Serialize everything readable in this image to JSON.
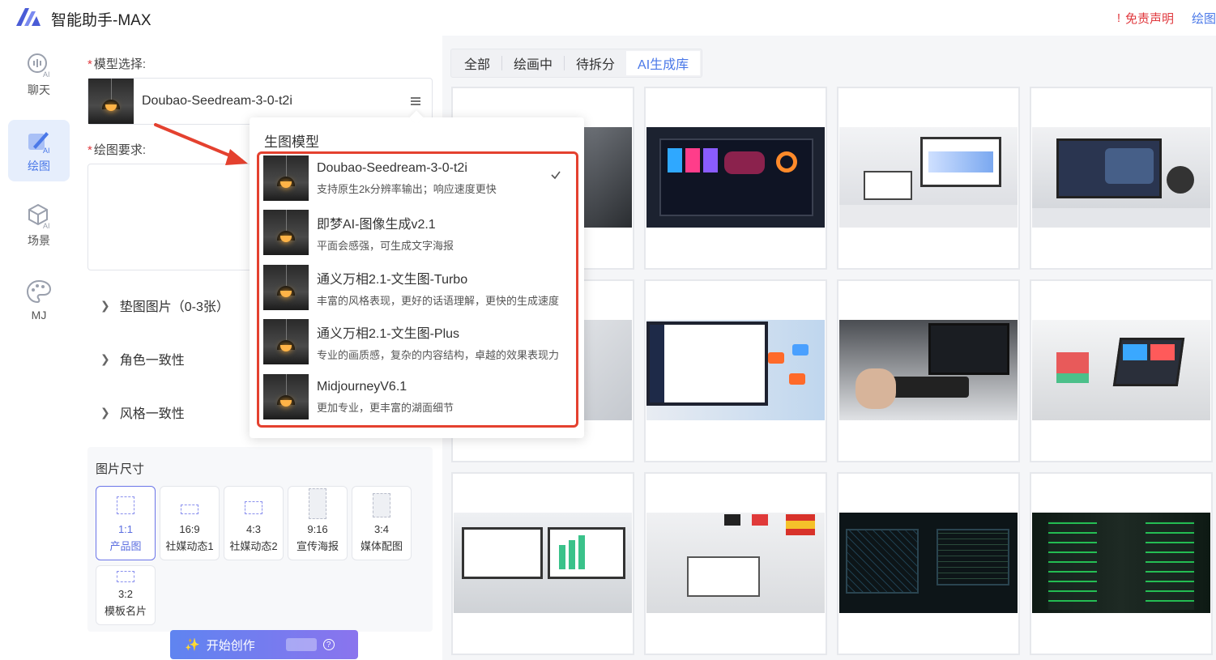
{
  "app": {
    "title": "智能助手-MAX",
    "disclaimer": "免责声明",
    "doc_link": "绘图文档",
    "accent": "#4a78e8",
    "danger": "#e0393e"
  },
  "nav": [
    {
      "label": "聊天",
      "icon": "chat-ai-icon"
    },
    {
      "label": "绘图",
      "icon": "paint-ai-icon",
      "active": true
    },
    {
      "label": "场景",
      "icon": "cube-ai-icon"
    },
    {
      "label": "MJ",
      "icon": "palette-icon"
    }
  ],
  "form": {
    "model_label": "模型选择:",
    "selected_model": "Doubao-Seedream-3-0-t2i",
    "prompt_label": "绘图要求:",
    "ref_images": "垫图图片（0-3张）",
    "char_consistency": "角色一致性",
    "style_consistency": "风格一致性",
    "size_title": "图片尺寸",
    "sizes": [
      {
        "ratio": "1:1",
        "name": "产品图"
      },
      {
        "ratio": "16:9",
        "name": "社媒动态1"
      },
      {
        "ratio": "4:3",
        "name": "社媒动态2"
      },
      {
        "ratio": "9:16",
        "name": "宣传海报"
      },
      {
        "ratio": "3:4",
        "name": "媒体配图"
      },
      {
        "ratio": "3:2",
        "name": "模板名片"
      }
    ],
    "start_button": "开始创作"
  },
  "tabs": [
    "全部",
    "绘画中",
    "待拆分",
    "AI生成库"
  ],
  "dropdown": {
    "title": "生图模型",
    "models": [
      {
        "name": "Doubao-Seedream-3-0-t2i",
        "desc": "支持原生2k分辨率输出；响应速度更快",
        "selected": true
      },
      {
        "name": "即梦AI-图像生成v2.1",
        "desc": "平面会感强，可生成文字海报"
      },
      {
        "name": "通义万相2.1-文生图-Turbo",
        "desc": "丰富的风格表现，更好的话语理解，更快的生成速度"
      },
      {
        "name": "通义万相2.1-文生图-Plus",
        "desc": "专业的画质感，复杂的内容结构，卓越的效果表现力"
      },
      {
        "name": "MidjourneyV6.1",
        "desc": "更加专业，更丰富的湖面细节"
      }
    ]
  }
}
